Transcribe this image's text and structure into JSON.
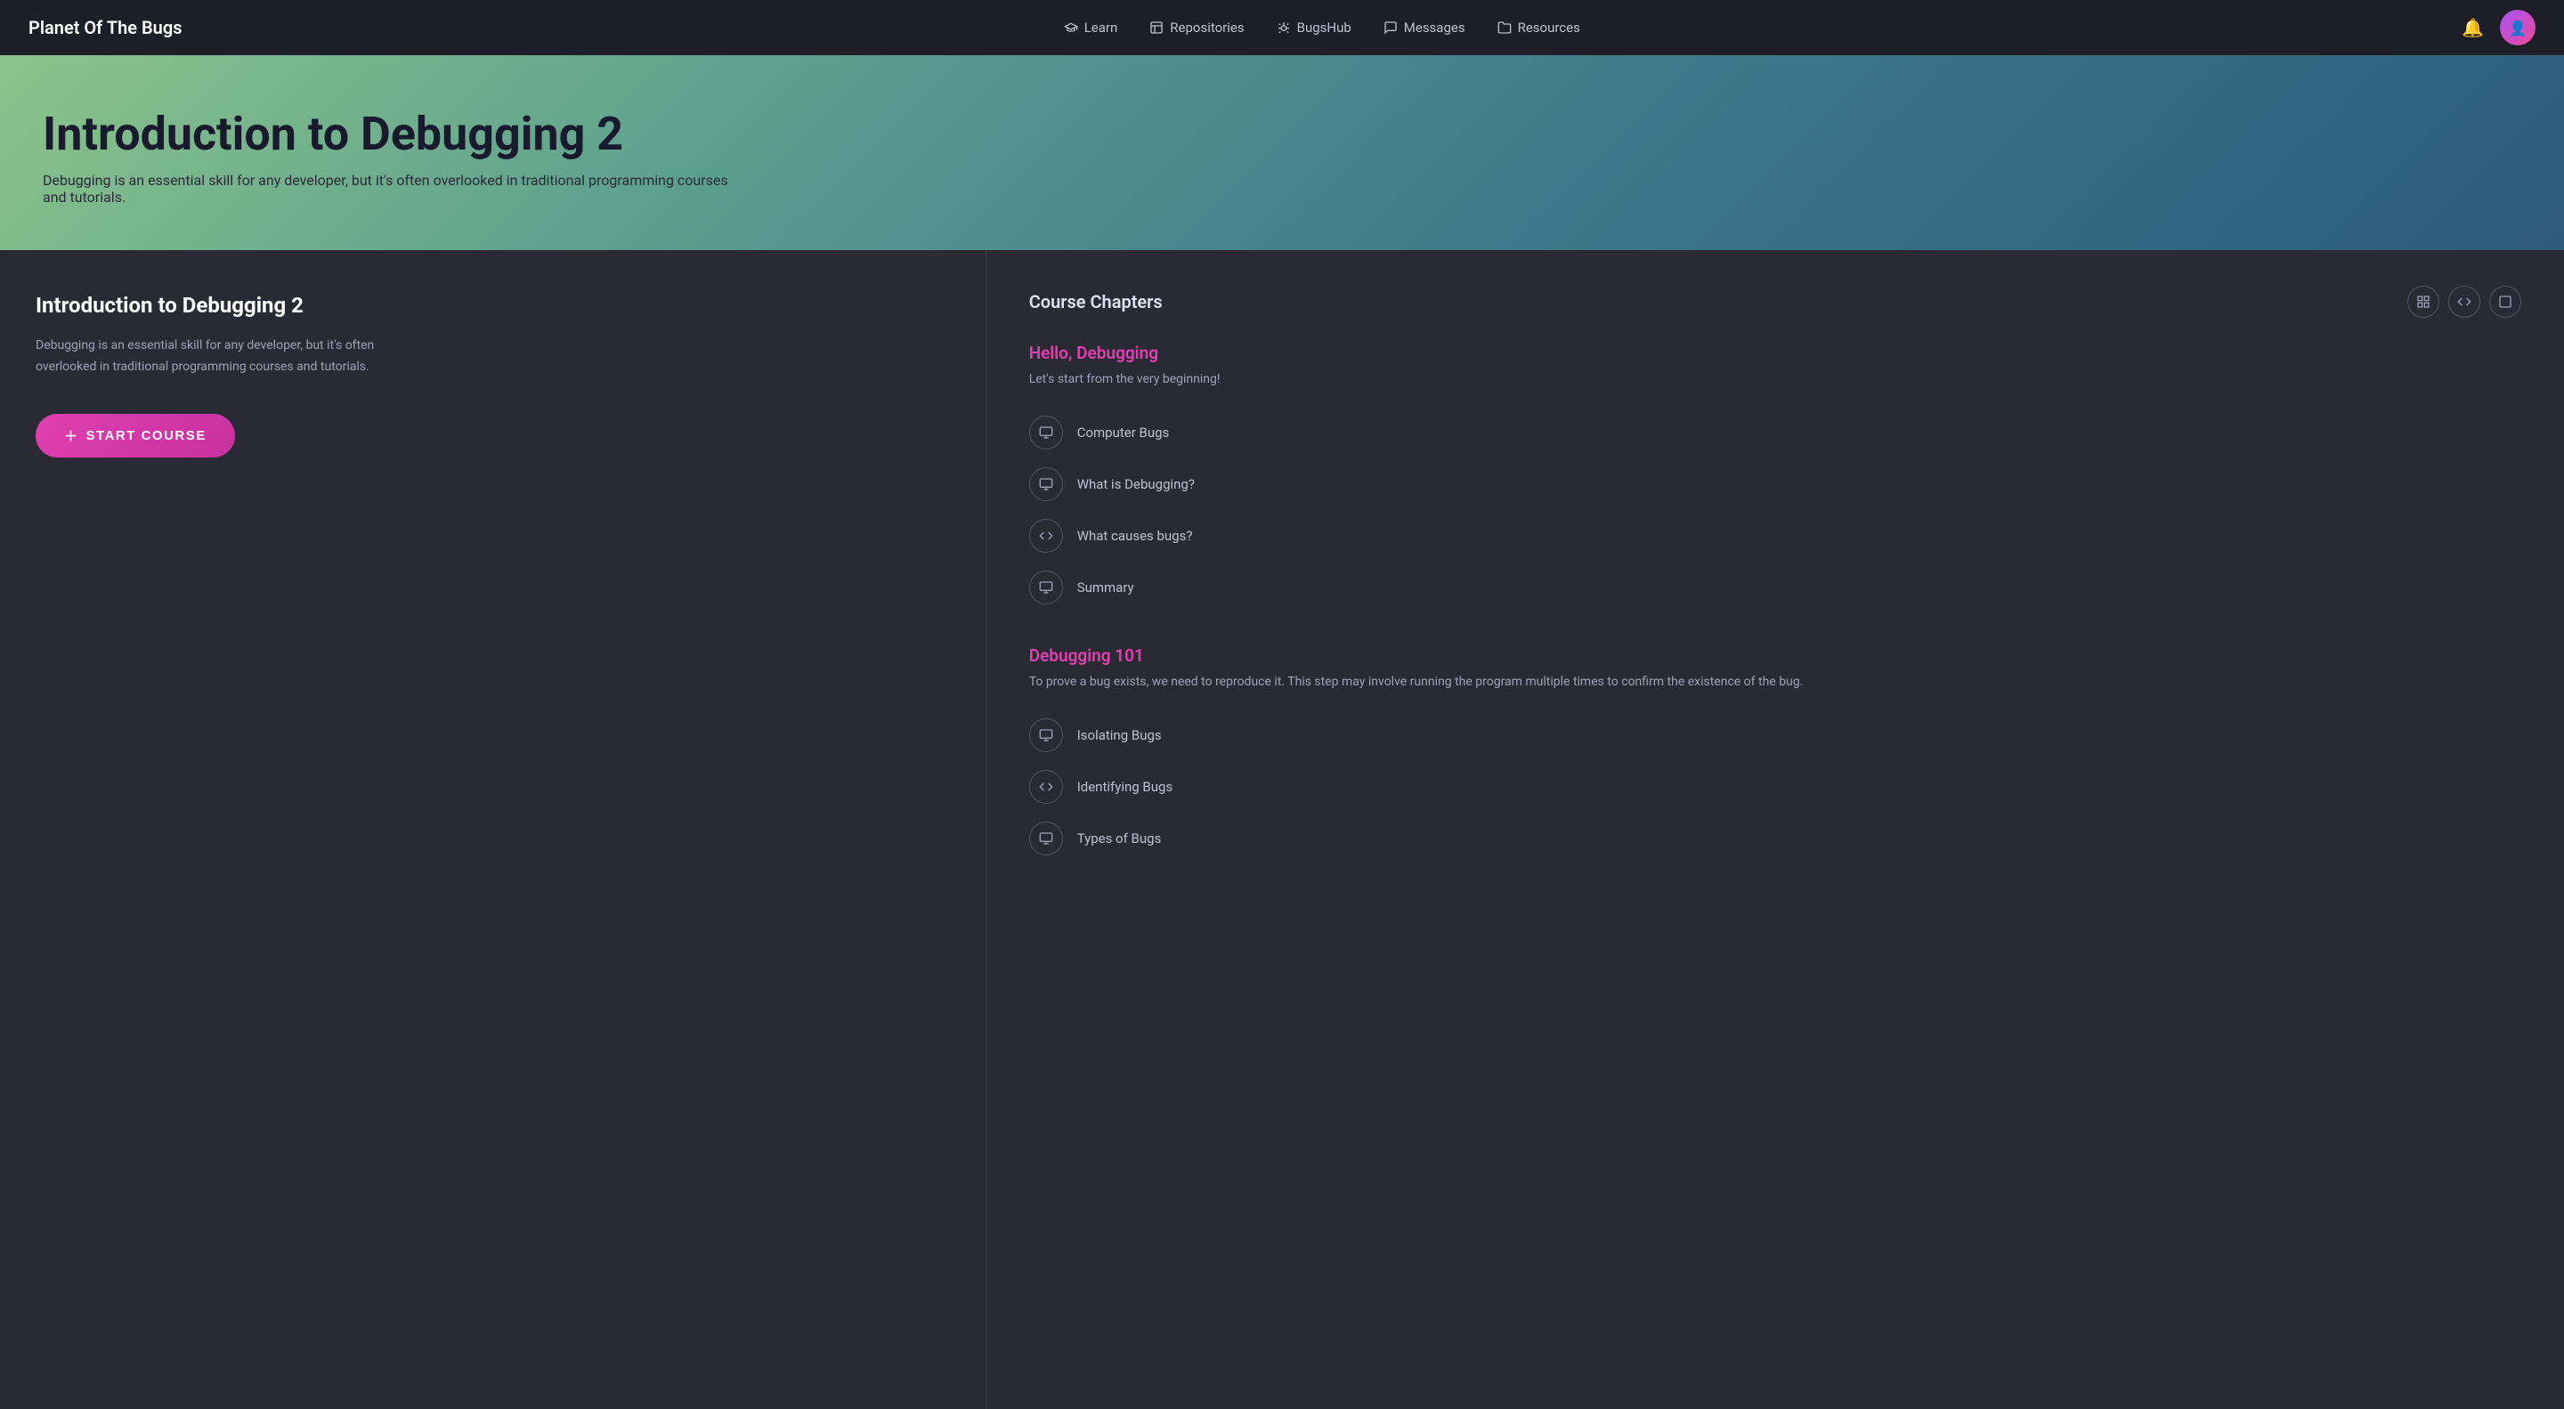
{
  "app": {
    "logo": "Planet Of The Bugs",
    "nav_links": [
      {
        "id": "learn",
        "label": "Learn",
        "icon": "graduation-cap"
      },
      {
        "id": "repositories",
        "label": "Repositories",
        "icon": "book"
      },
      {
        "id": "bugshub",
        "label": "BugsHub",
        "icon": "bug"
      },
      {
        "id": "messages",
        "label": "Messages",
        "icon": "chat"
      },
      {
        "id": "resources",
        "label": "Resources",
        "icon": "folder"
      }
    ]
  },
  "hero": {
    "title": "Introduction to Debugging 2",
    "subtitle": "Debugging is an essential skill for any developer, but it's often overlooked in traditional programming courses and tutorials."
  },
  "left_panel": {
    "course_title": "Introduction to Debugging 2",
    "course_desc": "Debugging is an essential skill for any developer, but it's often overlooked in traditional programming courses and tutorials.",
    "start_btn": "START COURSE"
  },
  "right_panel": {
    "chapters_title": "Course Chapters",
    "chapters": [
      {
        "id": "hello-debugging",
        "title": "Hello, Debugging",
        "desc": "Let's start from the very beginning!",
        "lessons": [
          {
            "id": "computer-bugs",
            "label": "Computer Bugs",
            "icon": "screen"
          },
          {
            "id": "what-is-debugging",
            "label": "What is Debugging?",
            "icon": "screen"
          },
          {
            "id": "what-causes-bugs",
            "label": "What causes bugs?",
            "icon": "code"
          },
          {
            "id": "summary-1",
            "label": "Summary",
            "icon": "screen"
          }
        ]
      },
      {
        "id": "debugging-101",
        "title": "Debugging 101",
        "desc": "To prove a bug exists, we need to reproduce it. This step may involve running the program multiple times to confirm the existence of the bug.",
        "lessons": [
          {
            "id": "isolating-bugs",
            "label": "Isolating Bugs",
            "icon": "screen"
          },
          {
            "id": "identifying-bugs",
            "label": "Identifying Bugs",
            "icon": "code"
          },
          {
            "id": "types-of-bugs",
            "label": "Types of Bugs",
            "icon": "screen"
          }
        ]
      }
    ],
    "view_controls": [
      "layout-icon",
      "code-icon",
      "box-icon"
    ]
  }
}
